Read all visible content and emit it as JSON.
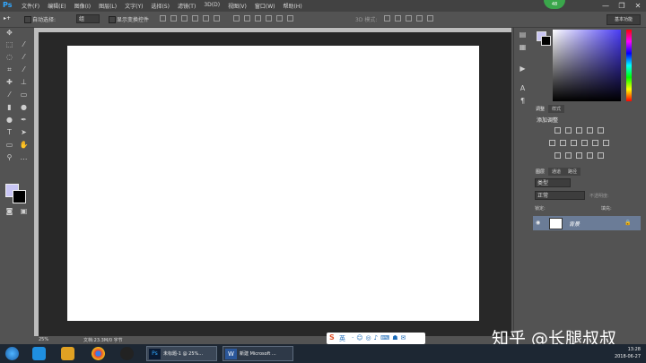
{
  "app": {
    "logo": "Ps",
    "notification_count": "48"
  },
  "menu": [
    "文件(F)",
    "编辑(E)",
    "图像(I)",
    "图层(L)",
    "文字(Y)",
    "选择(S)",
    "滤镜(T)",
    "3D(D)",
    "视图(V)",
    "窗口(W)",
    "帮助(H)"
  ],
  "window_controls": [
    "—",
    "❐",
    "✕"
  ],
  "options": {
    "auto_select_label": "自动选择:",
    "auto_select_value": "组",
    "show_transform_label": "显示变换控件",
    "mode_3d_label": "3D 模式:",
    "workspace": "基本功能"
  },
  "status": {
    "zoom": "25%",
    "doc_info": "文档:23.3M/0 字节"
  },
  "panels": {
    "adjust_tabs": [
      "调整",
      "样式"
    ],
    "add_adjustment": "添加调整",
    "layer_tabs": [
      "图层",
      "通道",
      "路径"
    ],
    "kind_filter": "类型",
    "blend_mode": "正常",
    "opacity_label": "不透明度:",
    "lock_label": "锁定:",
    "fill_label": "填充:",
    "layer_name": "背景"
  },
  "taskbar": {
    "ps_task": "未标题-1 @ 25%...",
    "word_task": "新建 Microsoft ...",
    "time": "13:28",
    "date": "2018-06-27"
  },
  "ime": {
    "label": "英"
  },
  "watermark": "知乎 @长腿叔叔",
  "colors": {
    "foreground": "#c9c6f5",
    "background": "#000000",
    "accent": "#31a8ff"
  }
}
